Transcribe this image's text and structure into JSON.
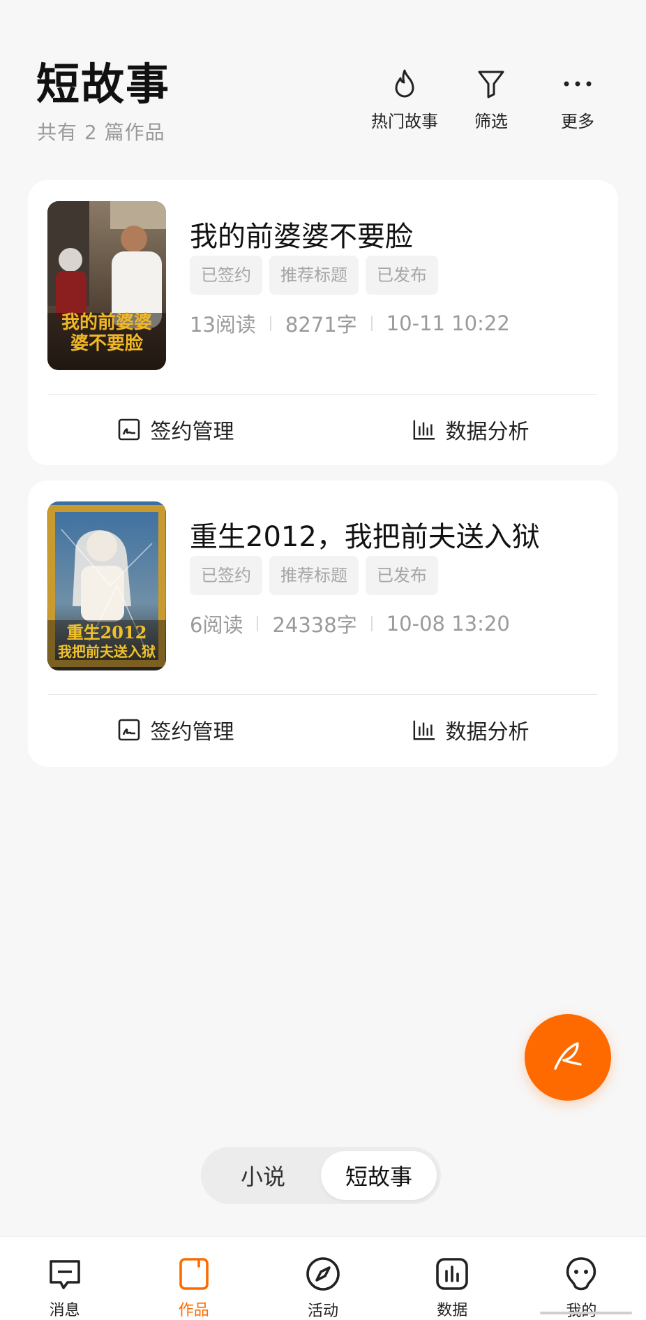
{
  "header": {
    "title": "短故事",
    "subtitle": "共有 2 篇作品",
    "actions": [
      {
        "label": "热门故事",
        "icon": "flame-icon"
      },
      {
        "label": "筛选",
        "icon": "filter-icon"
      },
      {
        "label": "更多",
        "icon": "more-icon"
      }
    ]
  },
  "stories": [
    {
      "title": "我的前婆婆不要脸",
      "tags": [
        "已签约",
        "推荐标题",
        "已发布"
      ],
      "reads": "13阅读",
      "words": "8271字",
      "updated": "10-11 10:22",
      "cover": {
        "line1": "我的前婆婆",
        "line2": "婆不要脸"
      },
      "actions": {
        "sign": "签约管理",
        "data": "数据分析"
      }
    },
    {
      "title": "重生2012，我把前夫送入狱",
      "tags": [
        "已签约",
        "推荐标题",
        "已发布"
      ],
      "reads": "6阅读",
      "words": "24338字",
      "updated": "10-08 13:20",
      "cover": {
        "line1": "重生2012",
        "line2": "我把前夫送入狱"
      },
      "actions": {
        "sign": "签约管理",
        "data": "数据分析"
      }
    }
  ],
  "segment": {
    "items": [
      "小说",
      "短故事"
    ],
    "active": "短故事"
  },
  "bottom_nav": [
    {
      "label": "消息",
      "icon": "message-icon"
    },
    {
      "label": "作品",
      "icon": "works-icon",
      "active": true
    },
    {
      "label": "活动",
      "icon": "compass-icon"
    },
    {
      "label": "数据",
      "icon": "chart-icon"
    },
    {
      "label": "我的",
      "icon": "profile-icon"
    }
  ],
  "colors": {
    "accent": "#ff6a00",
    "background": "#f7f7f7",
    "card": "#ffffff",
    "muted_text": "#9a9a9a",
    "tag_bg": "#f3f3f3"
  }
}
